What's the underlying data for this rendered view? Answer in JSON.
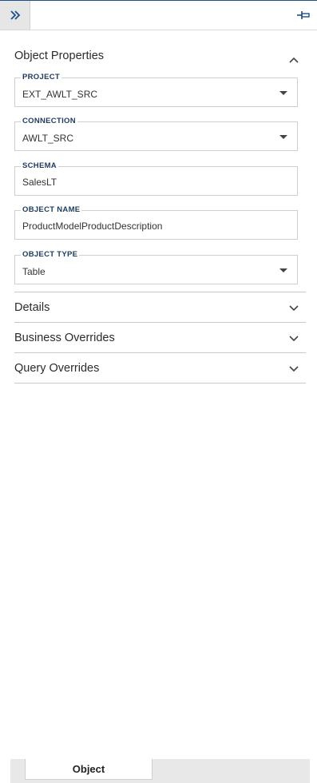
{
  "toolbar": {
    "expand_icon": "double-chevron-right-icon",
    "pin_icon": "pin-icon",
    "accent": "#1d4f8c"
  },
  "object_properties": {
    "title": "Object Properties",
    "expanded": true,
    "fields": {
      "project": {
        "label": "PROJECT",
        "value": "EXT_AWLT_SRC",
        "type": "dropdown"
      },
      "connection": {
        "label": "CONNECTION",
        "value": "AWLT_SRC",
        "type": "dropdown"
      },
      "schema": {
        "label": "SCHEMA",
        "value": "SalesLT",
        "type": "text"
      },
      "object_name": {
        "label": "OBJECT NAME",
        "value": "ProductModelProductDescription",
        "type": "text"
      },
      "object_type": {
        "label": "OBJECT TYPE",
        "value": "Table",
        "type": "dropdown"
      }
    }
  },
  "sections": {
    "details": {
      "title": "Details",
      "expanded": false
    },
    "business_overrides": {
      "title": "Business Overrides",
      "expanded": false
    },
    "query_overrides": {
      "title": "Query Overrides",
      "expanded": false
    }
  },
  "footer": {
    "tab_label": "Object"
  }
}
